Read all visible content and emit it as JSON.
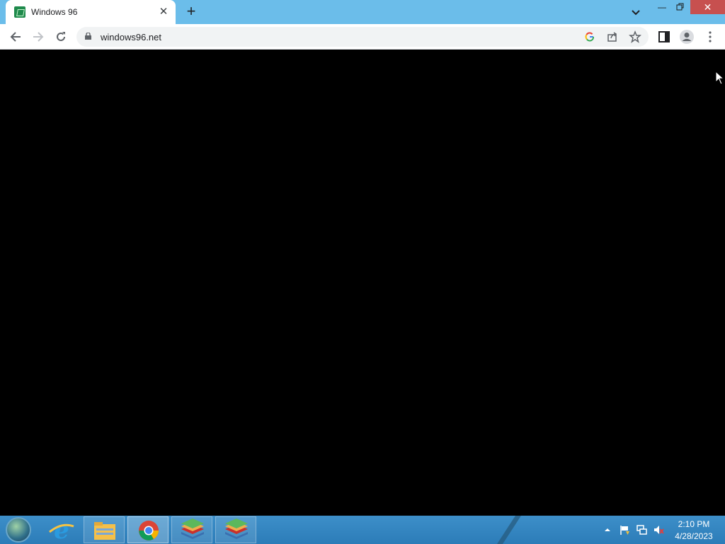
{
  "browser": {
    "tab": {
      "title": "Windows 96",
      "favicon": "windows96-logo-icon"
    },
    "url": "windows96.net",
    "colors": {
      "titlebar": "#6bbdea",
      "close_button": "#c7504f"
    }
  },
  "page": {
    "background": "#000000",
    "content": ""
  },
  "taskbar": {
    "pinned": [
      {
        "name": "internet-explorer",
        "icon": "internet-explorer-icon"
      },
      {
        "name": "file-explorer",
        "icon": "folder-icon"
      },
      {
        "name": "chrome",
        "icon": "chrome-icon",
        "active": true
      },
      {
        "name": "bluestacks-1",
        "icon": "bluestacks-icon"
      },
      {
        "name": "bluestacks-2",
        "icon": "bluestacks-icon"
      }
    ],
    "clock": {
      "time": "2:10 PM",
      "date": "4/28/2023"
    }
  }
}
